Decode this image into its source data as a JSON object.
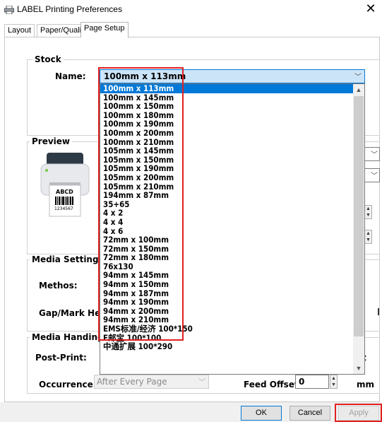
{
  "window": {
    "title": "LABEL Printing Preferences",
    "close_glyph": "✕"
  },
  "tabs": [
    {
      "label": "Layout"
    },
    {
      "label": "Paper/Quality"
    },
    {
      "label": "Page Setup"
    }
  ],
  "stock": {
    "group_label": "Stock",
    "name_label": "Name:",
    "name_value": "100mm x 113mm",
    "options": [
      "100mm x 113mm",
      "100mm x 145mm",
      "100mm x 150mm",
      "100mm x 180mm",
      "100mm x 190mm",
      "100mm x 200mm",
      "100mm x 210mm",
      "105mm x 145mm",
      "105mm x 150mm",
      "105mm x 190mm",
      "105mm x 200mm",
      "105mm x 210mm",
      "194mm x 87mm",
      "35+65",
      "4 x 2",
      "4 x 4",
      "4 x 6",
      "72mm x 100mm",
      "72mm x 150mm",
      "72mm x 180mm",
      "76x130",
      "94mm x 145mm",
      "94mm x 150mm",
      "94mm x 187mm",
      "94mm x 190mm",
      "94mm x 200mm",
      "94mm x 210mm",
      "EMS标准/经济 100*150",
      "E邮宝 100*100",
      "中通扩展 100*290"
    ],
    "selected_index": 0
  },
  "preview": {
    "group_label": "Preview",
    "label_text": "ABCD",
    "barcode_number": "1234567"
  },
  "media_settings": {
    "group_label": "Media Settings",
    "method_label": "Methos:",
    "gap_label": "Gap/Mark Height"
  },
  "media_handling": {
    "group_label": "Media Handing",
    "post_print_label": "Post-Print:",
    "occurrence_label": "Occurrence",
    "occurrence_value": "After Every Page",
    "feed_offset_label": "Feed Offset:",
    "feed_offset_value": "0",
    "feed_offset_unit": "mm",
    "cut_fragment": "t"
  },
  "buttons": {
    "ok": "OK",
    "cancel": "Cancel",
    "apply": "Apply"
  },
  "colors": {
    "accent": "#0078d7",
    "highlight_box": "#e02020"
  }
}
